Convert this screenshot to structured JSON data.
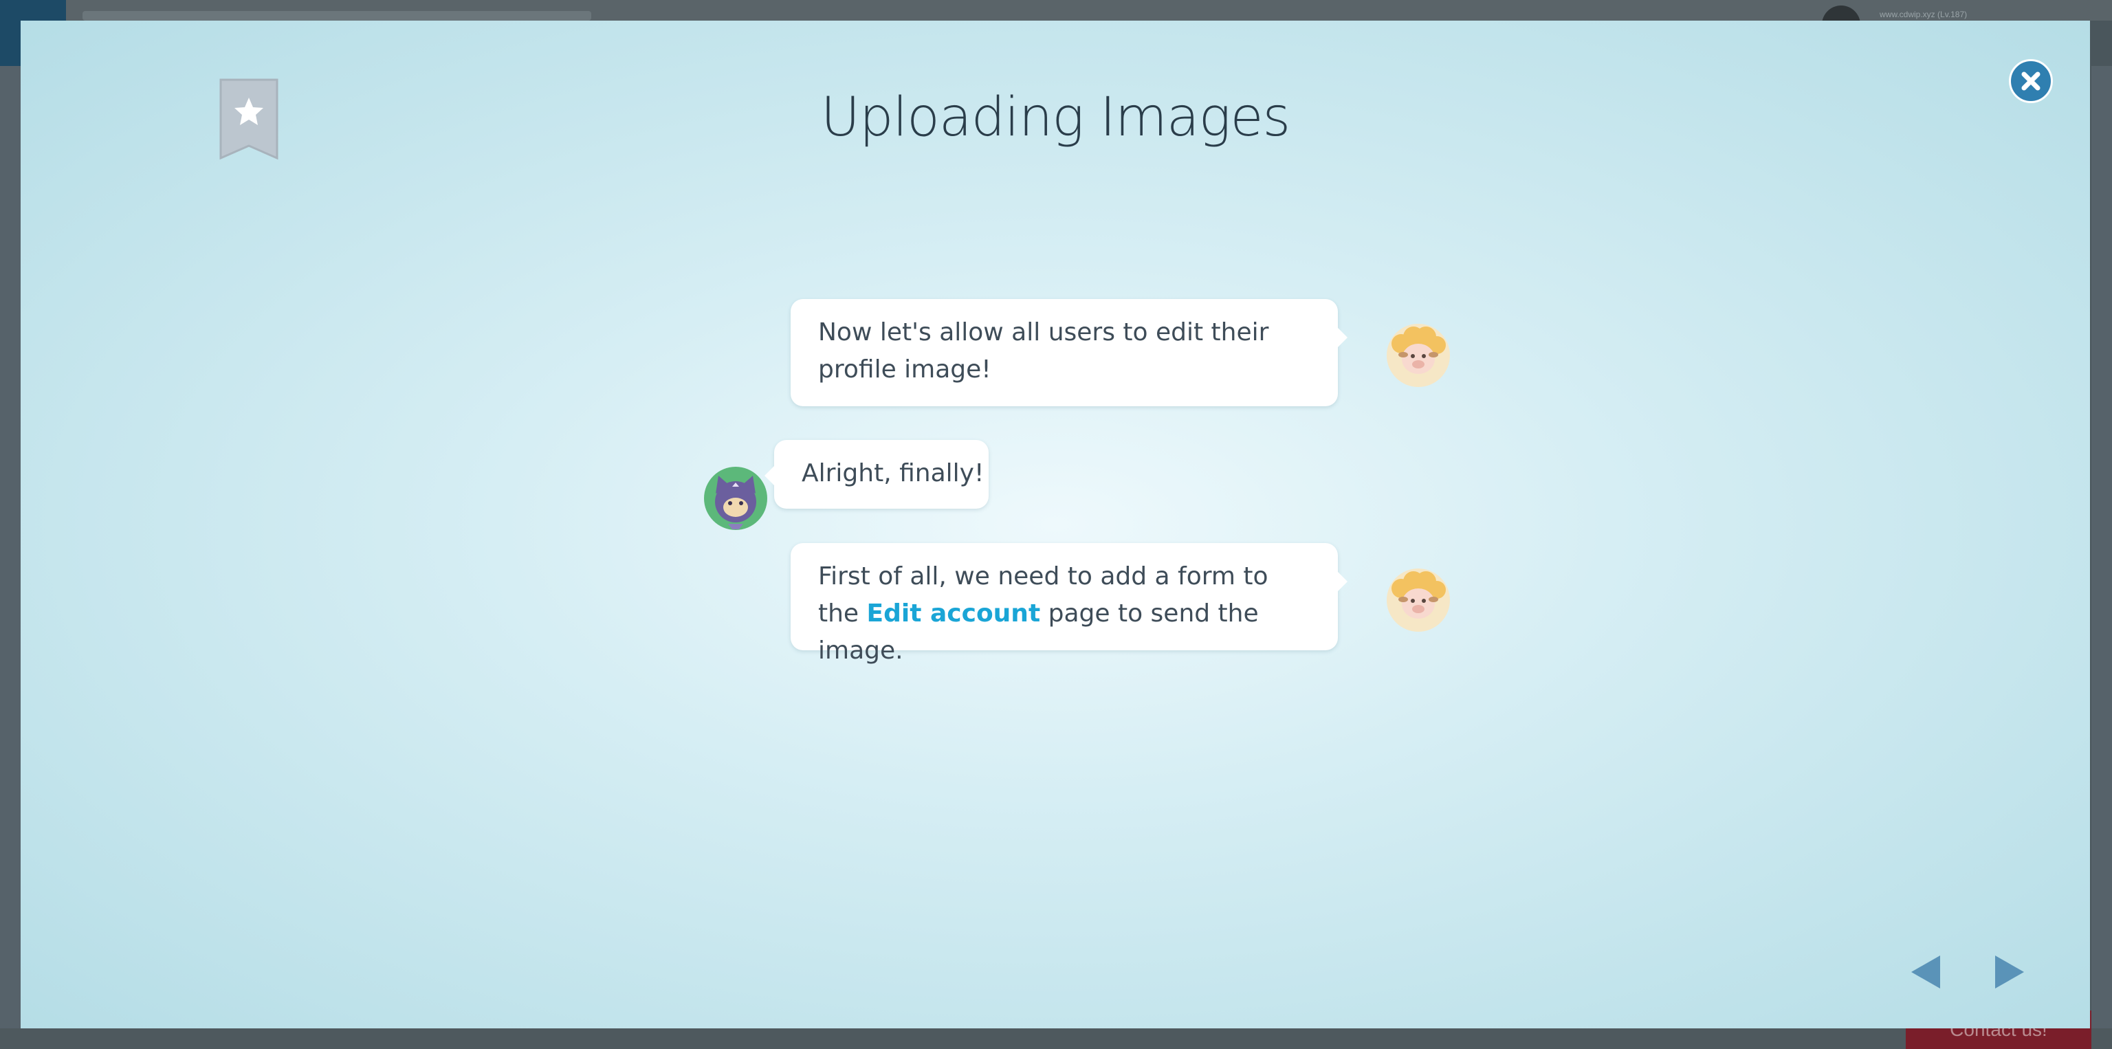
{
  "background": {
    "user_label": "www.cdwip.xyz (Lv.187)",
    "contact_label": "Contact us!"
  },
  "modal": {
    "title": "Uploading Images",
    "bookmark_icon": "bookmark-star-icon",
    "close_icon": "close-icon"
  },
  "dialogue": [
    {
      "speaker": "sheep",
      "text": "Now let's allow all users to edit their profile image!"
    },
    {
      "speaker": "cat",
      "text": "Alright, finally!"
    },
    {
      "speaker": "sheep",
      "text_before": "First of all, we need to add a form to the ",
      "link": "Edit account",
      "text_after": " page to send the image."
    }
  ],
  "navigation": {
    "prev_icon": "triangle-left-icon",
    "next_icon": "triangle-right-icon"
  },
  "colors": {
    "accent": "#2f7fb0",
    "link": "#1aa5d6",
    "title": "#2a3d4a",
    "nav": "#5a93b8"
  }
}
